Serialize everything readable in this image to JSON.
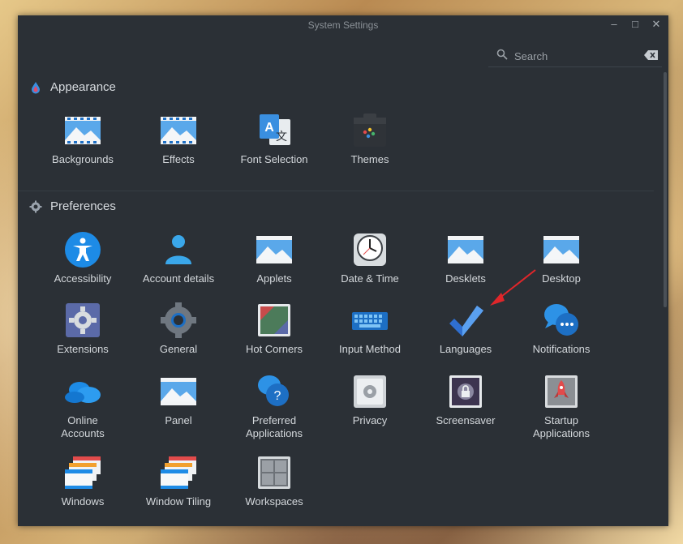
{
  "window": {
    "title": "System Settings",
    "controls": [
      "–",
      "□",
      "✕"
    ]
  },
  "search": {
    "placeholder": "Search"
  },
  "sections": {
    "appearance": {
      "title": "Appearance",
      "items": [
        "Backgrounds",
        "Effects",
        "Font Selection",
        "Themes"
      ]
    },
    "preferences": {
      "title": "Preferences",
      "items": [
        "Accessibility",
        "Account details",
        "Applets",
        "Date & Time",
        "Desklets",
        "Desktop",
        "Extensions",
        "General",
        "Hot Corners",
        "Input Method",
        "Languages",
        "Notifications",
        "Online\nAccounts",
        "Panel",
        "Preferred\nApplications",
        "Privacy",
        "Screensaver",
        "Startup\nApplications",
        "Windows",
        "Window Tiling",
        "Workspaces"
      ]
    }
  },
  "colors": {
    "window_bg": "#2b3036",
    "text": "#d4d8dc",
    "accent": "#3a8fe0",
    "arrow": "#e0262a"
  }
}
